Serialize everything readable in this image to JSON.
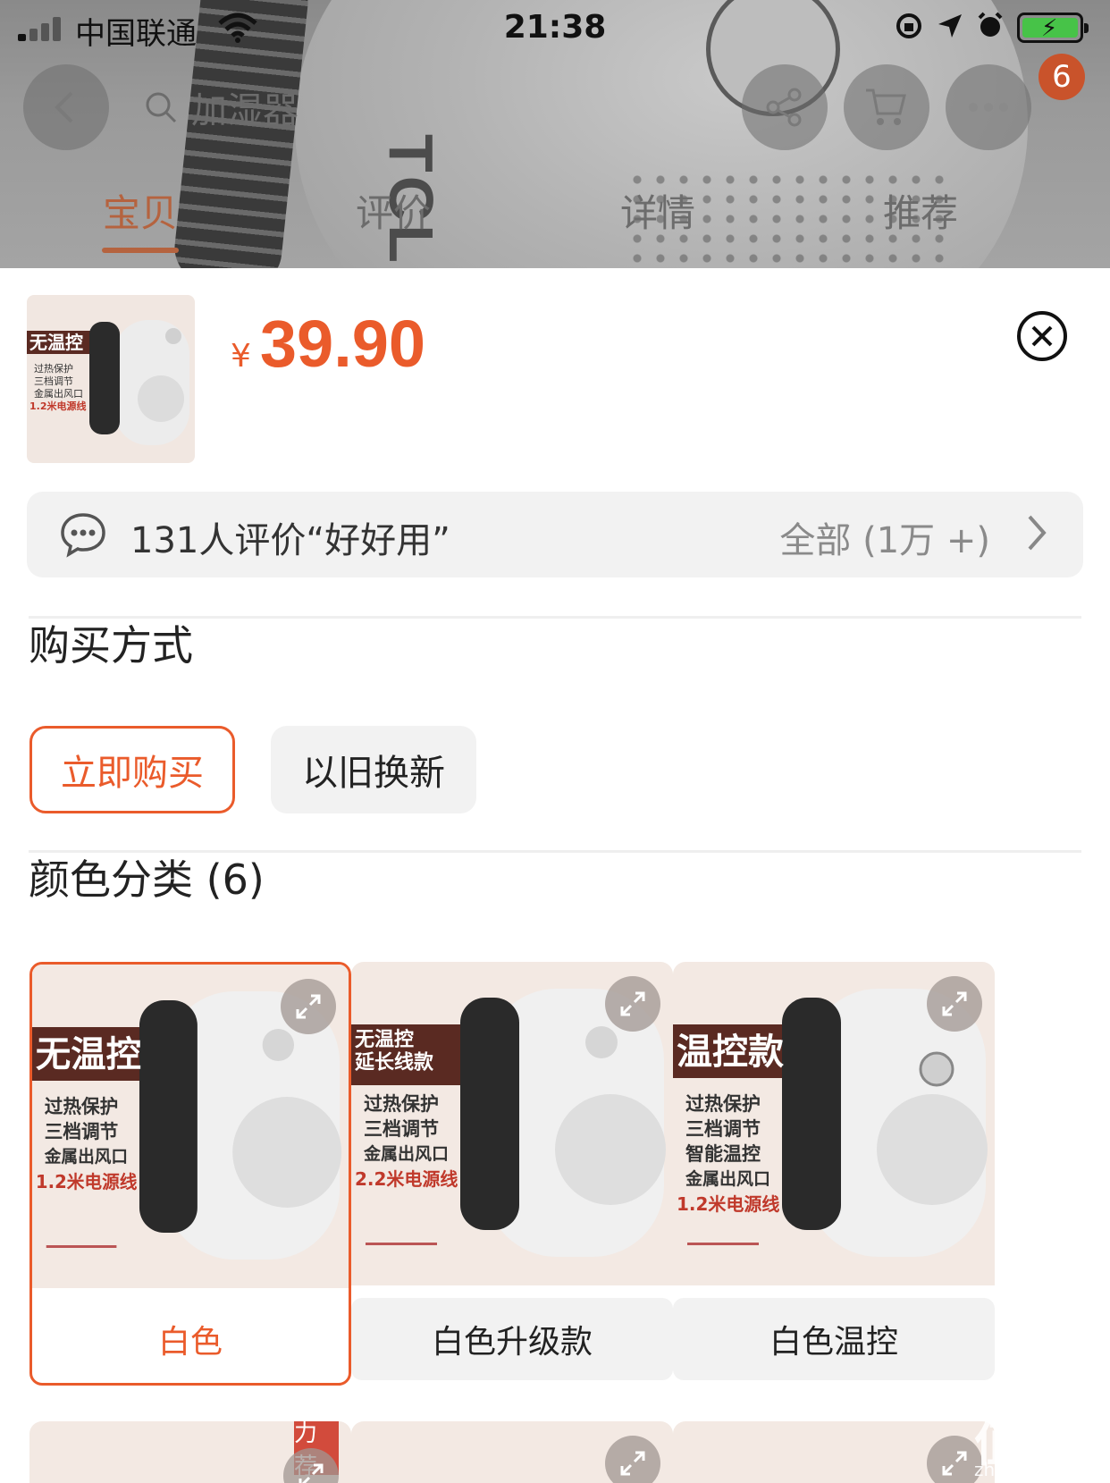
{
  "status_bar": {
    "carrier": "中国联通",
    "time": "21:38"
  },
  "header": {
    "search_placeholder": "加湿器",
    "cart_badge": "6",
    "tabs": [
      {
        "label": "宝贝",
        "active": true
      },
      {
        "label": "评价",
        "active": false
      },
      {
        "label": "详情",
        "active": false
      },
      {
        "label": "推荐",
        "active": false
      }
    ]
  },
  "sheet": {
    "currency": "¥",
    "price": "39.90",
    "thumb_text": {
      "tag": "无温控",
      "lines": [
        "过热保护",
        "三档调节",
        "金属出风口",
        "1.2米电源线"
      ]
    },
    "review": {
      "text": "131人评价“好好用”",
      "all": "全部 (1万 +)"
    },
    "purchase": {
      "title": "购买方式",
      "options": [
        {
          "label": "立即购买",
          "selected": true
        },
        {
          "label": "以旧换新",
          "selected": false
        }
      ]
    },
    "color": {
      "title": "颜色分类 (6)",
      "items": [
        {
          "label": "白色",
          "selected": true,
          "tag": "无温控",
          "lines": [
            "过热保护",
            "三档调节",
            "金属出风口",
            "1.2米电源线"
          ]
        },
        {
          "label": "白色升级款",
          "selected": false,
          "tag": "无温控\n延长线款",
          "lines": [
            "过热保护",
            "三档调节",
            "金属出风口",
            "2.2米电源线"
          ]
        },
        {
          "label": "白色温控",
          "selected": false,
          "tag": "温控款",
          "lines": [
            "过热保护",
            "三档调节",
            "智能温控",
            "金属出风口",
            "1.2米电源线"
          ]
        }
      ],
      "row2_tag": "力荐"
    }
  },
  "colors": {
    "accent": "#ea5b2b",
    "pill_bg": "#f2f2f2"
  }
}
